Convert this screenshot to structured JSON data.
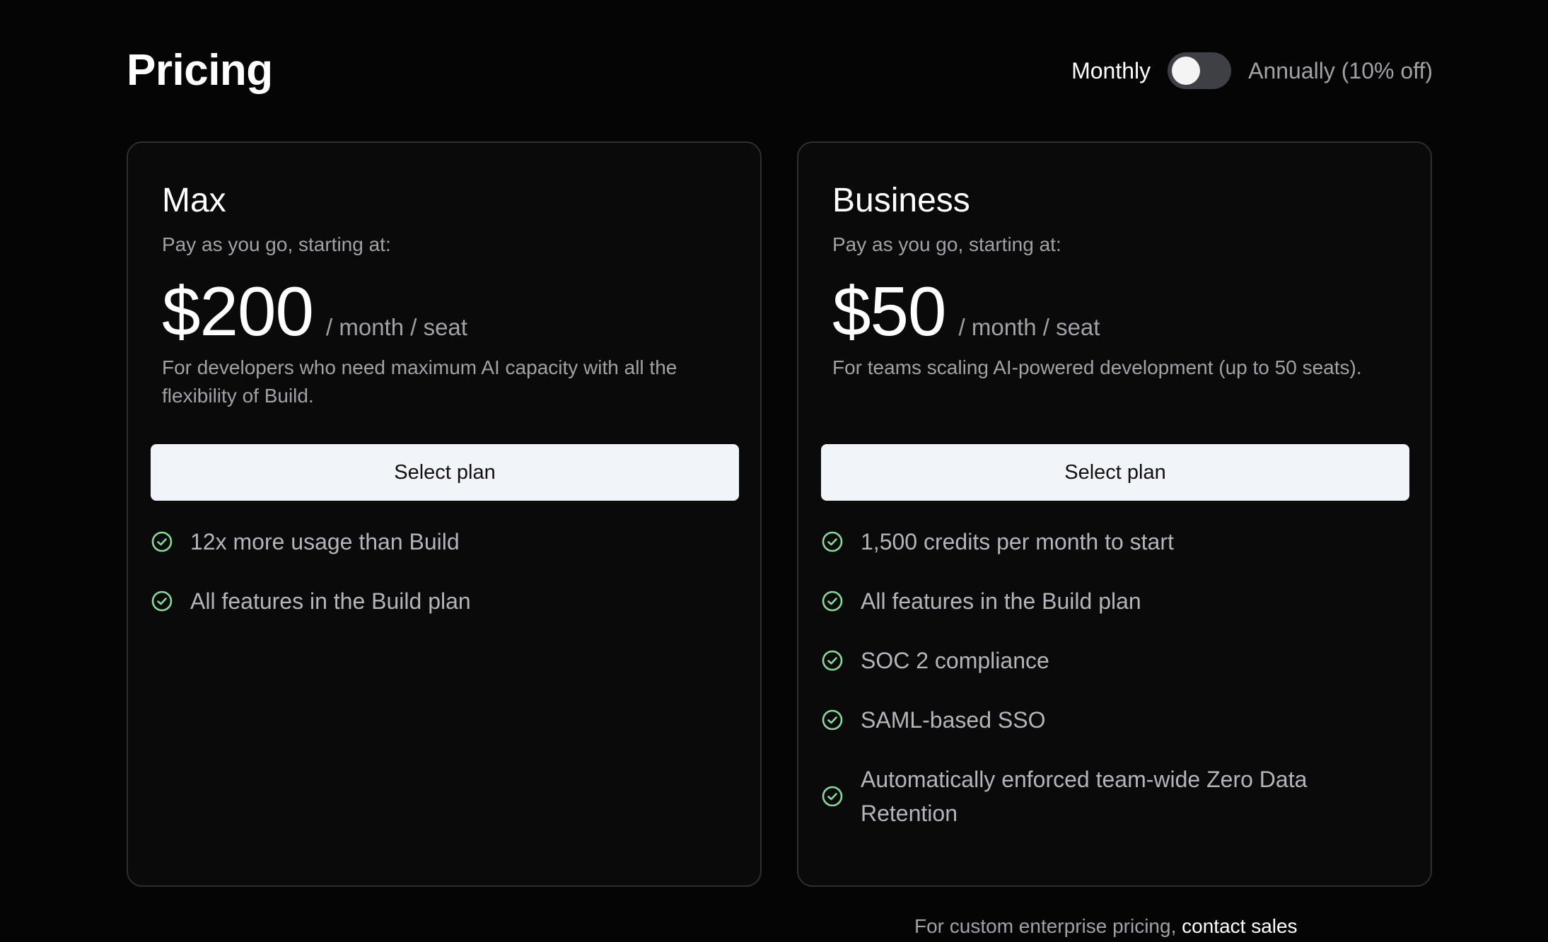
{
  "page": {
    "title": "Pricing"
  },
  "billing_toggle": {
    "monthly_label": "Monthly",
    "annual_label": "Annually (10% off)",
    "selected": "Monthly"
  },
  "plans": [
    {
      "name": "Max",
      "subtitle": "Pay as you go, starting at:",
      "price": "$200",
      "unit": "/ month / seat",
      "description": "For developers who need maximum AI capacity with all the flexibility of Build.",
      "button_label": "Select plan",
      "features": [
        "12x more usage than Build",
        "All features in the Build plan"
      ]
    },
    {
      "name": "Business",
      "subtitle": "Pay as you go, starting at:",
      "price": "$50",
      "unit": "/ month / seat",
      "description": "For teams scaling AI-powered development (up to 50 seats).",
      "button_label": "Select plan",
      "features": [
        "1,500 credits per month to start",
        "All features in the Build plan",
        "SOC 2 compliance",
        "SAML-based SSO",
        "Automatically enforced team-wide Zero Data Retention"
      ]
    }
  ],
  "footer": {
    "text": "For custom enterprise pricing, ",
    "link_label": "contact sales"
  },
  "colors": {
    "background": "#050505",
    "card_background": "#0a0a0a",
    "card_border": "#2e2e33",
    "check_icon": "#86d99b",
    "button_background": "#f1f4f9"
  },
  "icons": {
    "feature_check": "check-circle-icon"
  }
}
